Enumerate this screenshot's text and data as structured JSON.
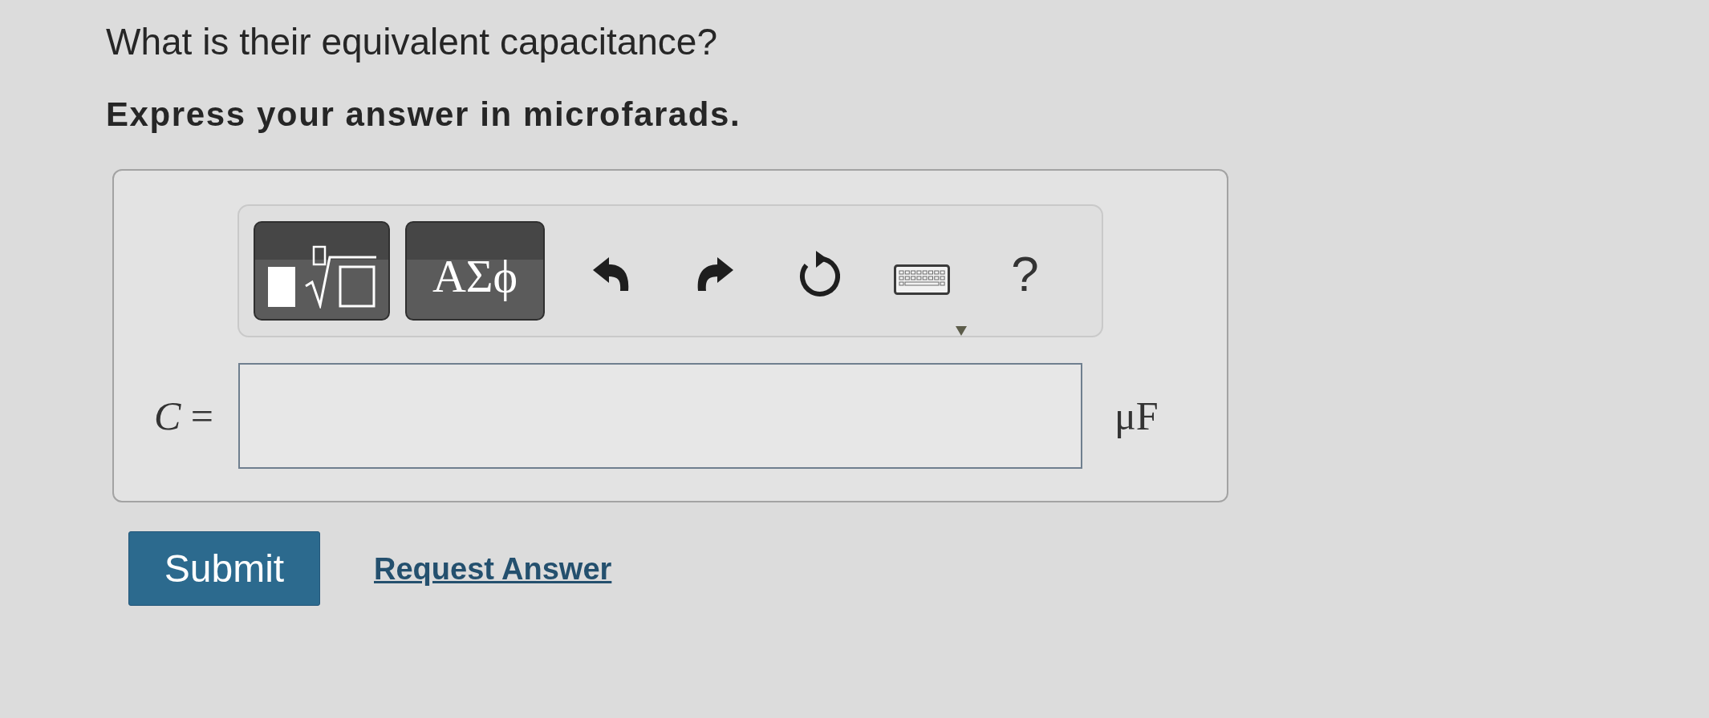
{
  "question": "What is their equivalent capacitance?",
  "instruction": "Express your answer in microfarads.",
  "answer_box": {
    "toolbar": [
      {
        "kind": "templates"
      },
      {
        "kind": "symbols",
        "label": "ΑΣϕ"
      },
      {
        "kind": "undo"
      },
      {
        "kind": "redo"
      },
      {
        "kind": "reset"
      },
      {
        "kind": "keyboard"
      },
      {
        "kind": "help",
        "label": "?"
      }
    ],
    "variable": "*C* =",
    "unit": "μF"
  },
  "actions": [
    {
      "kind": "submit",
      "label": "Submit"
    },
    {
      "kind": "link",
      "label": "Request Answer"
    }
  ]
}
